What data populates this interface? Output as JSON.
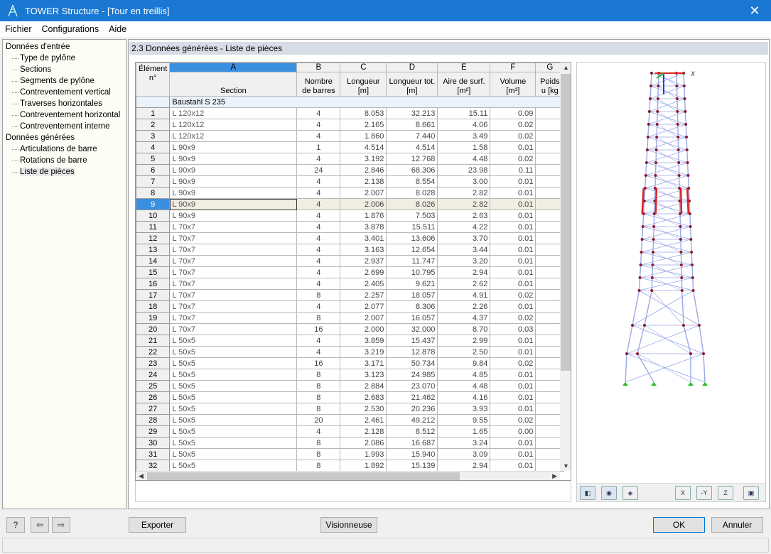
{
  "window": {
    "title": "TOWER Structure - [Tour en treillis]",
    "close": "✕"
  },
  "menu": [
    "Fichier",
    "Configurations",
    "Aide"
  ],
  "tree": {
    "groups": [
      {
        "label": "Données d'entrée",
        "items": [
          "Type de pylône",
          "Sections",
          "Segments de pylône",
          "Contreventement vertical",
          "Traverses horizontales",
          "Contreventement horizontal",
          "Contreventement interne"
        ]
      },
      {
        "label": "Données générées",
        "items": [
          "Articulations de barre",
          "Rotations de barre",
          "Liste de pièces"
        ]
      }
    ],
    "selected": "Liste de pièces"
  },
  "main": {
    "title": "2.3 Données générées - Liste de pièces"
  },
  "table": {
    "letters": [
      "A",
      "B",
      "C",
      "D",
      "E",
      "F",
      "G"
    ],
    "rowhead": "Élément n°",
    "headers": [
      "Section",
      "Nombre de barres",
      "Longueur [m]",
      "Longueur tot. [m]",
      "Aire de surf. [m²]",
      "Volume [m³]",
      "Poids u [kg"
    ],
    "group": "Baustahl S 235",
    "selected_row": 9,
    "rows": [
      [
        "1",
        "L 120x12",
        "4",
        "8.053",
        "32.213",
        "15.11",
        "0.09"
      ],
      [
        "2",
        "L 120x12",
        "4",
        "2.165",
        "8.661",
        "4.06",
        "0.02"
      ],
      [
        "3",
        "L 120x12",
        "4",
        "1.860",
        "7.440",
        "3.49",
        "0.02"
      ],
      [
        "4",
        "L 90x9",
        "1",
        "4.514",
        "4.514",
        "1.58",
        "0.01"
      ],
      [
        "5",
        "L 90x9",
        "4",
        "3.192",
        "12.768",
        "4.48",
        "0.02"
      ],
      [
        "6",
        "L 90x9",
        "24",
        "2.846",
        "68.306",
        "23.98",
        "0.11"
      ],
      [
        "7",
        "L 90x9",
        "4",
        "2.138",
        "8.554",
        "3.00",
        "0.01"
      ],
      [
        "8",
        "L 90x9",
        "4",
        "2.007",
        "8.028",
        "2.82",
        "0.01"
      ],
      [
        "9",
        "L 90x9",
        "4",
        "2.006",
        "8.026",
        "2.82",
        "0.01"
      ],
      [
        "10",
        "L 90x9",
        "4",
        "1.876",
        "7.503",
        "2.63",
        "0.01"
      ],
      [
        "11",
        "L 70x7",
        "4",
        "3.878",
        "15.511",
        "4.22",
        "0.01"
      ],
      [
        "12",
        "L 70x7",
        "4",
        "3.401",
        "13.606",
        "3.70",
        "0.01"
      ],
      [
        "13",
        "L 70x7",
        "4",
        "3.163",
        "12.654",
        "3.44",
        "0.01"
      ],
      [
        "14",
        "L 70x7",
        "4",
        "2.937",
        "11.747",
        "3.20",
        "0.01"
      ],
      [
        "15",
        "L 70x7",
        "4",
        "2.699",
        "10.795",
        "2.94",
        "0.01"
      ],
      [
        "16",
        "L 70x7",
        "4",
        "2.405",
        "9.621",
        "2.62",
        "0.01"
      ],
      [
        "17",
        "L 70x7",
        "8",
        "2.257",
        "18.057",
        "4.91",
        "0.02"
      ],
      [
        "18",
        "L 70x7",
        "4",
        "2.077",
        "8.306",
        "2.26",
        "0.01"
      ],
      [
        "19",
        "L 70x7",
        "8",
        "2.007",
        "16.057",
        "4.37",
        "0.02"
      ],
      [
        "20",
        "L 70x7",
        "16",
        "2.000",
        "32.000",
        "8.70",
        "0.03"
      ],
      [
        "21",
        "L 50x5",
        "4",
        "3.859",
        "15.437",
        "2.99",
        "0.01"
      ],
      [
        "22",
        "L 50x5",
        "4",
        "3.219",
        "12.878",
        "2.50",
        "0.01"
      ],
      [
        "23",
        "L 50x5",
        "16",
        "3.171",
        "50.734",
        "9.84",
        "0.02"
      ],
      [
        "24",
        "L 50x5",
        "8",
        "3.123",
        "24.985",
        "4.85",
        "0.01"
      ],
      [
        "25",
        "L 50x5",
        "8",
        "2.884",
        "23.070",
        "4.48",
        "0.01"
      ],
      [
        "26",
        "L 50x5",
        "8",
        "2.683",
        "21.462",
        "4.16",
        "0.01"
      ],
      [
        "27",
        "L 50x5",
        "8",
        "2.530",
        "20.236",
        "3.93",
        "0.01"
      ],
      [
        "28",
        "L 50x5",
        "20",
        "2.461",
        "49.212",
        "9.55",
        "0.02"
      ],
      [
        "29",
        "L 50x5",
        "4",
        "2.128",
        "8.512",
        "1.65",
        "0.00"
      ],
      [
        "30",
        "L 50x5",
        "8",
        "2.086",
        "16.687",
        "3.24",
        "0.01"
      ],
      [
        "31",
        "L 50x5",
        "8",
        "1.993",
        "15.940",
        "3.09",
        "0.01"
      ],
      [
        "32",
        "L 50x5",
        "8",
        "1.892",
        "15.139",
        "2.94",
        "0.01"
      ]
    ]
  },
  "view": {
    "axis_label": "X",
    "toolbar": [
      "view-iso",
      "view-member",
      "view-render",
      "X",
      "-Y",
      "Z",
      "box"
    ]
  },
  "buttons": {
    "export": "Exporter",
    "viewer": "Visionneuse",
    "ok": "OK",
    "cancel": "Annuler"
  },
  "colors": {
    "titlebar": "#1a78d2",
    "selection": "#3b8fe0",
    "highlight_member": "#e02020",
    "member": "#9aa8e8",
    "node": "#8b1a2a",
    "support": "#22bb22"
  }
}
